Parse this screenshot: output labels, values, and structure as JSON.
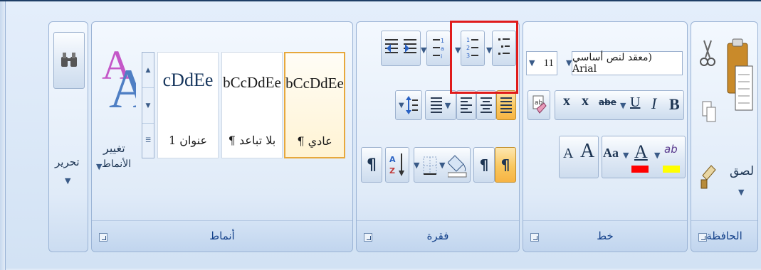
{
  "ribbon": {
    "clipboard": {
      "title": "الحافظة",
      "paste_label": "لصق",
      "icons": [
        "paste-icon",
        "cut-icon",
        "copy-icon",
        "format-painter-icon"
      ]
    },
    "font": {
      "title": "خط",
      "font_name": "معقد لنص أساسي) Arial",
      "font_size": "11",
      "bold": "B",
      "italic": "I",
      "underline": "U",
      "strikethrough": "abe",
      "subscript": "x",
      "superscript": "x",
      "change_case": "Aa",
      "font_color_letter": "A",
      "highlight_text": "ab",
      "grow_font": "A",
      "shrink_font": "A",
      "font_color_bar": "#ff0000",
      "highlight_bar": "#ffff00"
    },
    "paragraph": {
      "title": "فقرة",
      "pilcrow": "¶",
      "sort_icon": "sort-az-icon",
      "ltr": "¶",
      "rtl": "¶"
    },
    "styles": {
      "title": "أنماط",
      "items": [
        {
          "sample": "bCcDdEe",
          "name": "¶ عادي",
          "selected": true
        },
        {
          "sample": "bCcDdEe",
          "name": "¶ بلا تباعد",
          "selected": false
        },
        {
          "sample": "cDdEe",
          "name": "عنوان 1",
          "selected": false
        }
      ],
      "change_styles_line1": "تغيير",
      "change_styles_line2": "الأنماط"
    },
    "editing": {
      "label": "تحرير"
    }
  },
  "highlight_color": "#e01b1b",
  "accent_color": "#f7b444"
}
